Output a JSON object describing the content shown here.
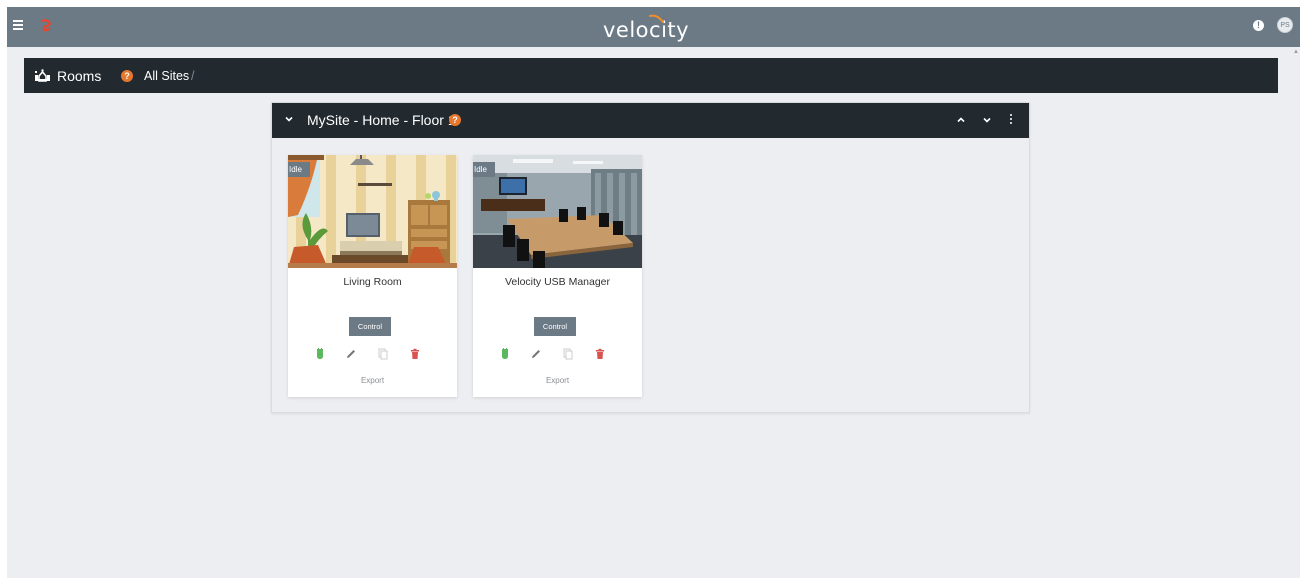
{
  "topbar": {
    "logo_text": "velocity",
    "avatar_initials": "PS",
    "info_symbol": "!",
    "menu_icon": "hamburger-icon",
    "app_icon": "velocity-sway-icon",
    "bar_color": "#6c7a86"
  },
  "breadcrumb": {
    "title": "Rooms",
    "help_symbol": "?",
    "site_link": "All Sites",
    "separator": "/",
    "icon": "rooms-icon"
  },
  "site_panel": {
    "title": "MySite - Home - Floor 1",
    "help_symbol": "?",
    "header_color": "#222a30"
  },
  "rooms": [
    {
      "name": "Living Room",
      "status": "Idle",
      "control_label": "Control",
      "export_label": "Export",
      "image": "living-room-illustration"
    },
    {
      "name": "Velocity USB Manager",
      "status": "Idle",
      "control_label": "Control",
      "export_label": "Export",
      "image": "conference-room-photo"
    }
  ],
  "colors": {
    "accent_orange": "#e8772e",
    "power_green": "#5cb85c",
    "delete_red": "#d9534f",
    "background": "#edeef1"
  }
}
